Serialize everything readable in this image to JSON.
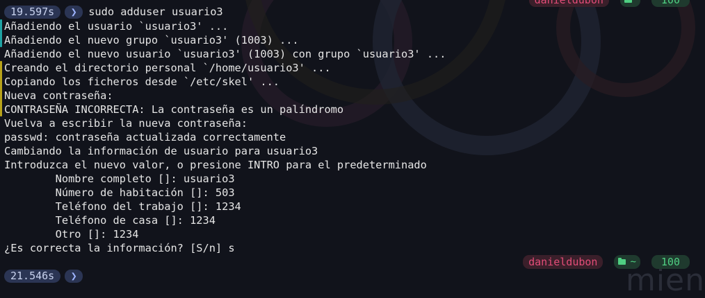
{
  "prompt_top": {
    "timer": "19.597s",
    "command": "sudo adduser usuario3"
  },
  "right_prompt_top": {
    "user": "danieldubon",
    "dir": "",
    "battery": "100"
  },
  "output_lines": [
    "Añadiendo el usuario `usuario3' ...",
    "Añadiendo el nuevo grupo `usuario3' (1003) ...",
    "Añadiendo el nuevo usuario `usuario3' (1003) con grupo `usuario3' ...",
    "Creando el directorio personal `/home/usuario3' ...",
    "Copiando los ficheros desde `/etc/skel' ...",
    "Nueva contraseña:",
    "CONTRASEÑA INCORRECTA: La contraseña es un palíndromo",
    "Vuelva a escribir la nueva contraseña:",
    "passwd: contraseña actualizada correctamente",
    "Cambiando la información de usuario para usuario3",
    "Introduzca el nuevo valor, o presione INTRO para el predeterminado",
    "        Nombre completo []: usuario3",
    "        Número de habitación []: 503",
    "        Teléfono del trabajo []: 1234",
    "        Teléfono de casa []: 1234",
    "        Otro []: 1234",
    "¿Es correcta la información? [S/n] s"
  ],
  "right_prompt_bottom": {
    "user": "danieldubon",
    "dir": "~",
    "battery": "100"
  },
  "prompt_bottom": {
    "timer": "21.546s",
    "chevron": "❯"
  },
  "chevron": "❯",
  "watermark": "mien",
  "colors": {
    "background": "#11131b",
    "pill": "#2b3554",
    "user": "#e34d78",
    "dir": "#4fcf82"
  }
}
